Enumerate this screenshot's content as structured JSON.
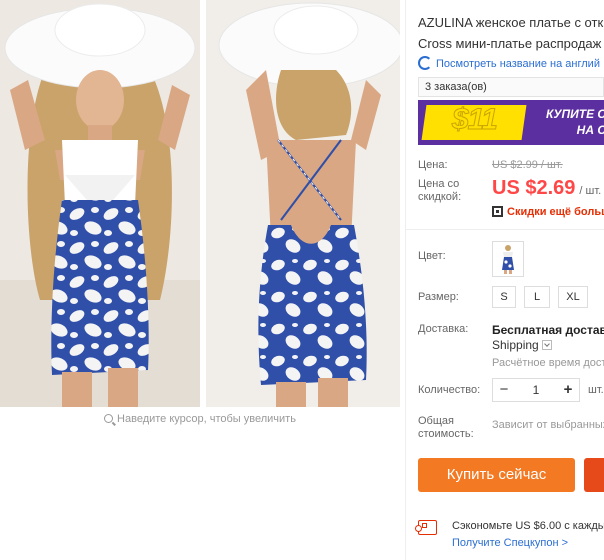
{
  "gallery": {
    "zoom_hint": "Наведите курсор, чтобы увеличить"
  },
  "product": {
    "title_line1": "AZULINA женское платье с отк",
    "title_line2": "Cross мини-платье распродаж",
    "translate_link": "Посмотреть название на англий",
    "orders": "3 заказа(ов)"
  },
  "banner": {
    "price": "$11",
    "cta_line1": "КУПИТЕ С",
    "cta_line2": "НА С",
    "colors": {
      "background": "#5b2f9f",
      "accent": "#ffe000"
    }
  },
  "price": {
    "label": "Цена:",
    "old_value": "US $2.99 / шт.",
    "discount_label_1": "Цена со",
    "discount_label_2": "скидкой:",
    "new_value": "US $2.69",
    "unit": "/ шт.",
    "extra_discount": "Скидки ещё больш",
    "color": "#ff4747"
  },
  "options": {
    "color_label": "Цвет:",
    "size_label": "Размер:",
    "sizes": [
      "S",
      "L",
      "XL"
    ]
  },
  "shipping": {
    "label": "Доставка:",
    "free": "Бесплатная доставка",
    "method": "Shipping",
    "eta": "Расчётное время доста"
  },
  "quantity": {
    "label": "Количество:",
    "minus": "−",
    "value": "1",
    "plus": "+",
    "unit": "шт."
  },
  "total": {
    "label_1": "Общая",
    "label_2": "стоимость:",
    "value": "Зависит от выбранных"
  },
  "actions": {
    "buy_now": "Купить сейчас",
    "buy_color": "#f37a23"
  },
  "coupon": {
    "save_text": "Сэкономьте US $6.00 с каждых",
    "link": "Получите Спецкупон >"
  }
}
